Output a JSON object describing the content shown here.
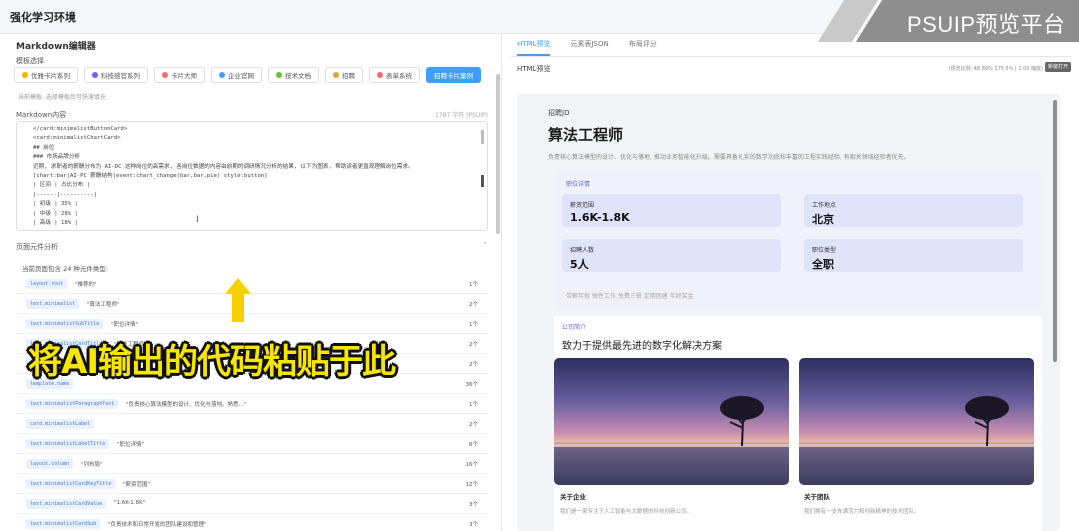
{
  "app": {
    "title": "强化学习环境"
  },
  "overlay": {
    "brand": "PSUIP预览平台",
    "caption": "将AI输出的代码粘贴于此"
  },
  "editor_panel": {
    "section_title": "Markdown编辑器",
    "templates_label": "模板选择",
    "templates": [
      {
        "label": "优雅卡片系列",
        "color": "#f5b400"
      },
      {
        "label": "科技感官系列",
        "color": "#7a5af8"
      },
      {
        "label": "卡片大师",
        "color": "#f56c6c"
      },
      {
        "label": "企业官网",
        "color": "#409eff"
      },
      {
        "label": "技术文档",
        "color": "#67c23a"
      },
      {
        "label": "招聘",
        "color": "#e6a23c"
      },
      {
        "label": "表单系统",
        "color": "#f56c6c"
      },
      {
        "label": "招聘卡片案例",
        "active": true
      }
    ],
    "hint": "当前模板: 选择模板后可快速填充",
    "editor_title": "Markdown内容",
    "char_count": "1787 字符 (PSUIP)",
    "code_lines": [
      "</card:minimalistButtonCard>",
      "<card:minimalistChartCard>",
      "## 岗位",
      "### 市场品牌分析",
      "近期, 求职者的薪酬分布为 AI-DC 这种岗位的高需求, 各岗位数据的内容由前期的调研情况分析的结果, 以下为图表, 帮助读者更直观理解岗位需求。",
      "",
      "[chart:bar|AI-PC 薪酬结构|event:chart_change(bar,bar,pie) style:button]",
      "| 区间 | 占比分布 |",
      "|------|----------|",
      "| 初级 | 35% |",
      "| 中级 | 28% |",
      "| 高级 | 18% |"
    ],
    "analysis_title": "页面元件分析",
    "analysis_subtitle": "当前页面包含 24 种元件类型:",
    "components": [
      {
        "tag": "layout.root",
        "value": "\"推荐的\"",
        "count": "1个"
      },
      {
        "tag": "text.minimalist",
        "value": "\"算法工程师\"",
        "count": "2个"
      },
      {
        "tag": "text.minimalistSubTitle",
        "value": "\"职位详情\"",
        "count": "1个"
      },
      {
        "tag": "text.minimalistCardTitle",
        "value": "\"算法工程师\"",
        "count": "2个"
      },
      {
        "tag": "text.minimalistSectionTitle",
        "value": "\"算法工程师\"",
        "count": "2个"
      },
      {
        "tag": "template.name",
        "value": "",
        "count": "36个"
      },
      {
        "tag": "text.minimalistParagraphText",
        "value": "\"负责核心算法模型的设计、优化与落地。熟悉...\"",
        "count": "1个"
      },
      {
        "tag": "card.minimalistLabel",
        "value": "",
        "count": "2个"
      },
      {
        "tag": "text.minimalistLabelTitle",
        "value": "\"职位详情\"",
        "count": "6个"
      },
      {
        "tag": "layout.column",
        "value": "\"列布局\"",
        "count": "16个"
      },
      {
        "tag": "text.minimalistCardKeyTitle",
        "value": "\"薪资范围\"",
        "count": "12个"
      },
      {
        "tag": "text.minimalistCardValue",
        "value": "\"1.6K-1.8K\"",
        "count": "3个"
      },
      {
        "tag": "text.minimalistCardSub",
        "value": "\"负责技术和日常开发的团队建设和管理\"",
        "count": "3个"
      }
    ]
  },
  "preview_panel": {
    "tabs": [
      {
        "label": "HTML预览",
        "active": true
      },
      {
        "label": "元素表JSON",
        "active": false
      },
      {
        "label": "布局评分",
        "active": false
      }
    ],
    "preview_label": "HTML预览",
    "preview_meta": "(预览比例: 48.89% 175.5% | 1.00 缩放)",
    "open_button": "新窗打开",
    "job": {
      "id_label": "招聘JD",
      "title": "算法工程师",
      "description": "负责核心算法模型的设计、优化与落地, 推动业务智能化升级。需要具备扎实的数学功底和丰富的工程实践经验, 有相关领域经验者优先。",
      "details_heading": "职位详情",
      "details": [
        {
          "key": "薪资范围",
          "value": "1.6K-1.8K"
        },
        {
          "key": "工作地点",
          "value": "北京"
        },
        {
          "key": "招聘人数",
          "value": "5人"
        },
        {
          "key": "职位类型",
          "value": "全职"
        }
      ],
      "benefits": "带薪年假 弹性工作 免费三餐 定期团建 年终奖金",
      "company_heading": "公司简介",
      "company_slogan": "致力于提供最先进的数字化解决方案",
      "photos": [
        {
          "caption": "关于企业",
          "desc": "我们是一家专注于人工智能与大数据的科技创新公司。"
        },
        {
          "caption": "关于团队",
          "desc": "我们拥有一支充满活力和创新精神的技术团队。"
        }
      ]
    }
  }
}
